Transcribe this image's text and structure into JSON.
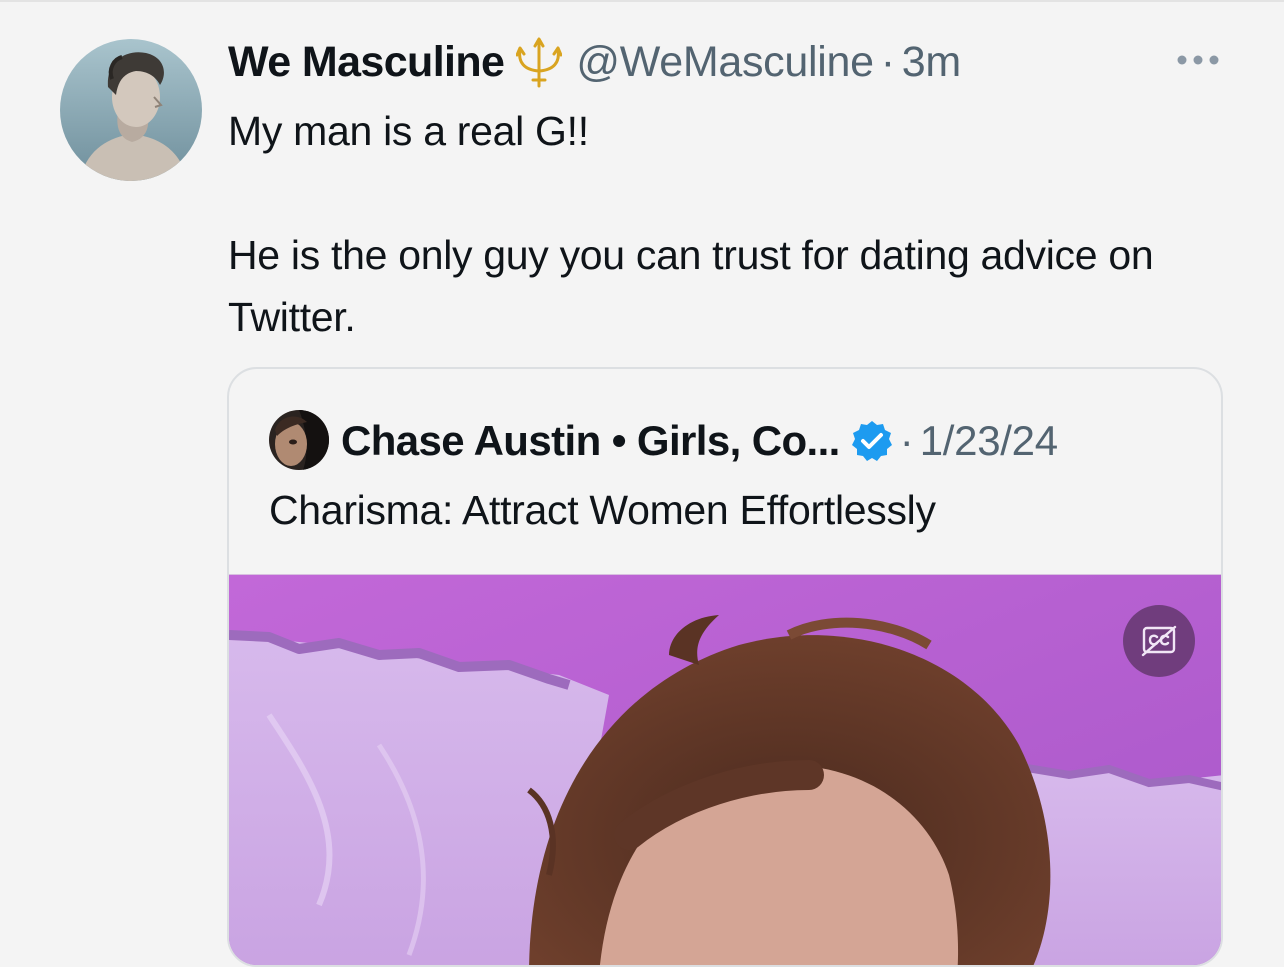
{
  "tweet": {
    "display_name": "We Masculine",
    "handle": "@WeMasculine",
    "separator": "·",
    "time": "3m",
    "text": "My man is a real G!!\n\nHe is the only guy you can trust for dating advice on Twitter.",
    "badge_icon": "trident-icon",
    "more_icon": "more-options-icon"
  },
  "quote": {
    "display_name": "Chase Austin • Girls, Co...",
    "verified_icon": "verified-badge-icon",
    "separator": "·",
    "time": "1/23/24",
    "text": "Charisma: Attract Women Effortlessly",
    "media_type": "video",
    "captions_icon": "captions-off-icon"
  },
  "colors": {
    "background": "#f4f4f4",
    "text": "#0f1419",
    "secondary_text": "#536471",
    "verified": "#1d9bf0",
    "card_border": "#dcdfe2",
    "video_bg": "#b865d6"
  }
}
